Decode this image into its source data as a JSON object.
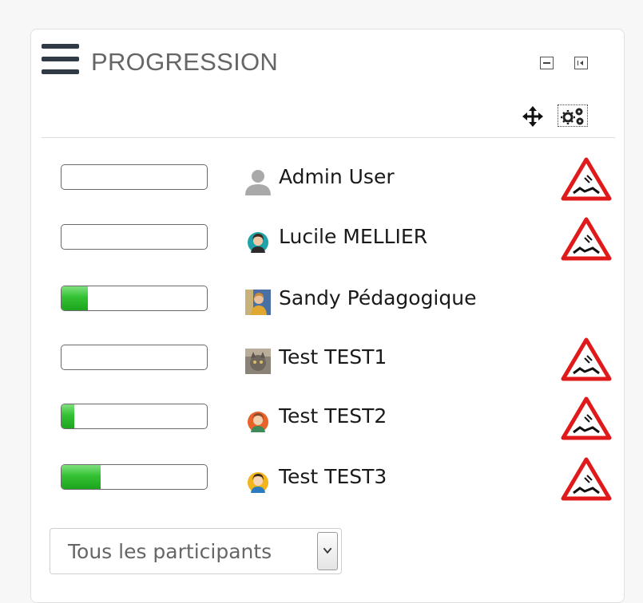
{
  "block": {
    "title": "PROGRESSION"
  },
  "icons": {
    "menu": "hamburger-icon",
    "minimize": "minimize-icon",
    "dock": "dock-icon",
    "move": "move-icon",
    "actions": "gears-icon",
    "warning": "warning-triangle-icon"
  },
  "colors": {
    "progress_fill": "#33c233",
    "warning_red": "#e0191a",
    "title_text": "#666666"
  },
  "participants": [
    {
      "name": "Admin User",
      "progress": 0.0,
      "warning": true,
      "avatar": "default-user-icon"
    },
    {
      "name": "Lucile MELLIER",
      "progress": 0.0,
      "warning": true,
      "avatar": "user-photo"
    },
    {
      "name": "Sandy Pédagogique",
      "progress": 0.18,
      "warning": false,
      "avatar": "user-photo"
    },
    {
      "name": "Test TEST1",
      "progress": 0.0,
      "warning": true,
      "avatar": "user-photo"
    },
    {
      "name": "Test TEST2",
      "progress": 0.09,
      "warning": true,
      "avatar": "user-photo"
    },
    {
      "name": "Test TEST3",
      "progress": 0.27,
      "warning": true,
      "avatar": "user-photo"
    }
  ],
  "filter": {
    "selected": "Tous les participants"
  }
}
